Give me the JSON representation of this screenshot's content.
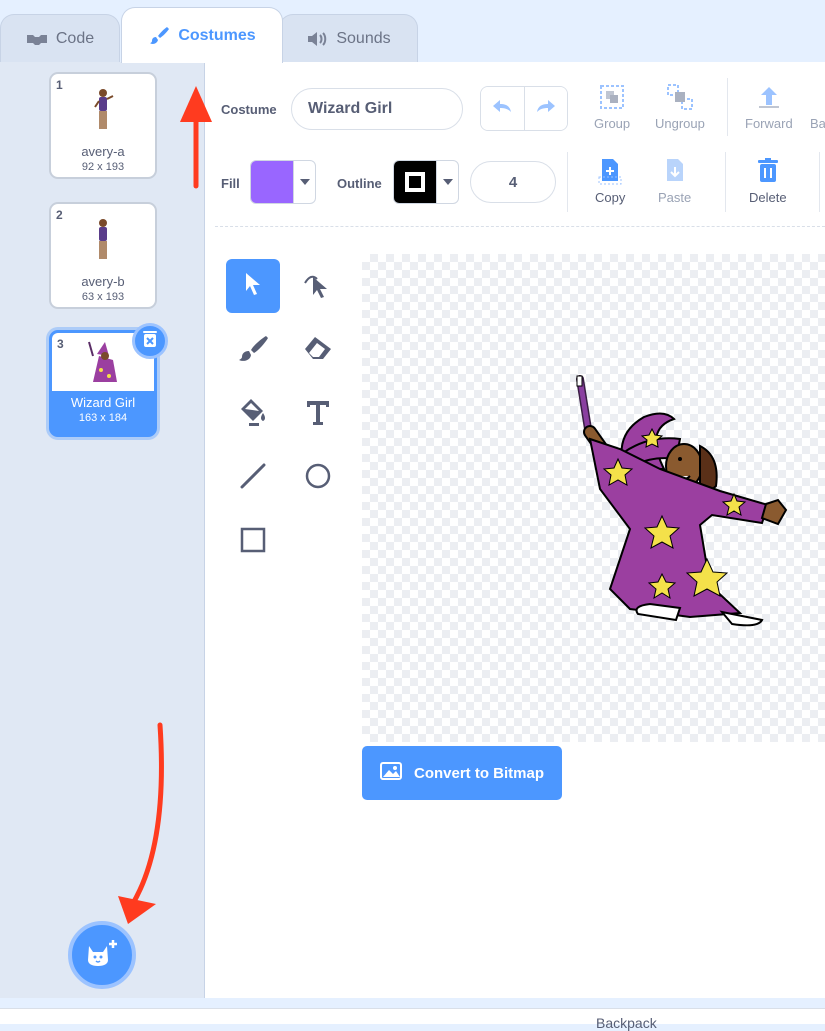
{
  "tabs": [
    {
      "label": "Code",
      "icon": "code-icon"
    },
    {
      "label": "Costumes",
      "icon": "brush-icon",
      "active": true
    },
    {
      "label": "Sounds",
      "icon": "speaker-icon"
    }
  ],
  "costumes": [
    {
      "num": "1",
      "name": "avery-a",
      "size": "92 x 193"
    },
    {
      "num": "2",
      "name": "avery-b",
      "size": "63 x 193"
    },
    {
      "num": "3",
      "name": "Wizard Girl",
      "size": "163 x 184",
      "selected": true
    }
  ],
  "editor": {
    "costume_label": "Costume",
    "costume_name": "Wizard Girl",
    "fill_label": "Fill",
    "outline_label": "Outline",
    "outline_width": "4",
    "fill_color": "#9966ff",
    "outline_color": "#000000",
    "buttons": {
      "group": "Group",
      "ungroup": "Ungroup",
      "forward": "Forward",
      "back": "Ba",
      "copy": "Copy",
      "paste": "Paste",
      "delete": "Delete"
    },
    "convert_label": "Convert to Bitmap"
  },
  "backpack_label": "Backpack",
  "colors": {
    "accent": "#4c97ff",
    "annotation_arrow": "#ff3b1f"
  }
}
